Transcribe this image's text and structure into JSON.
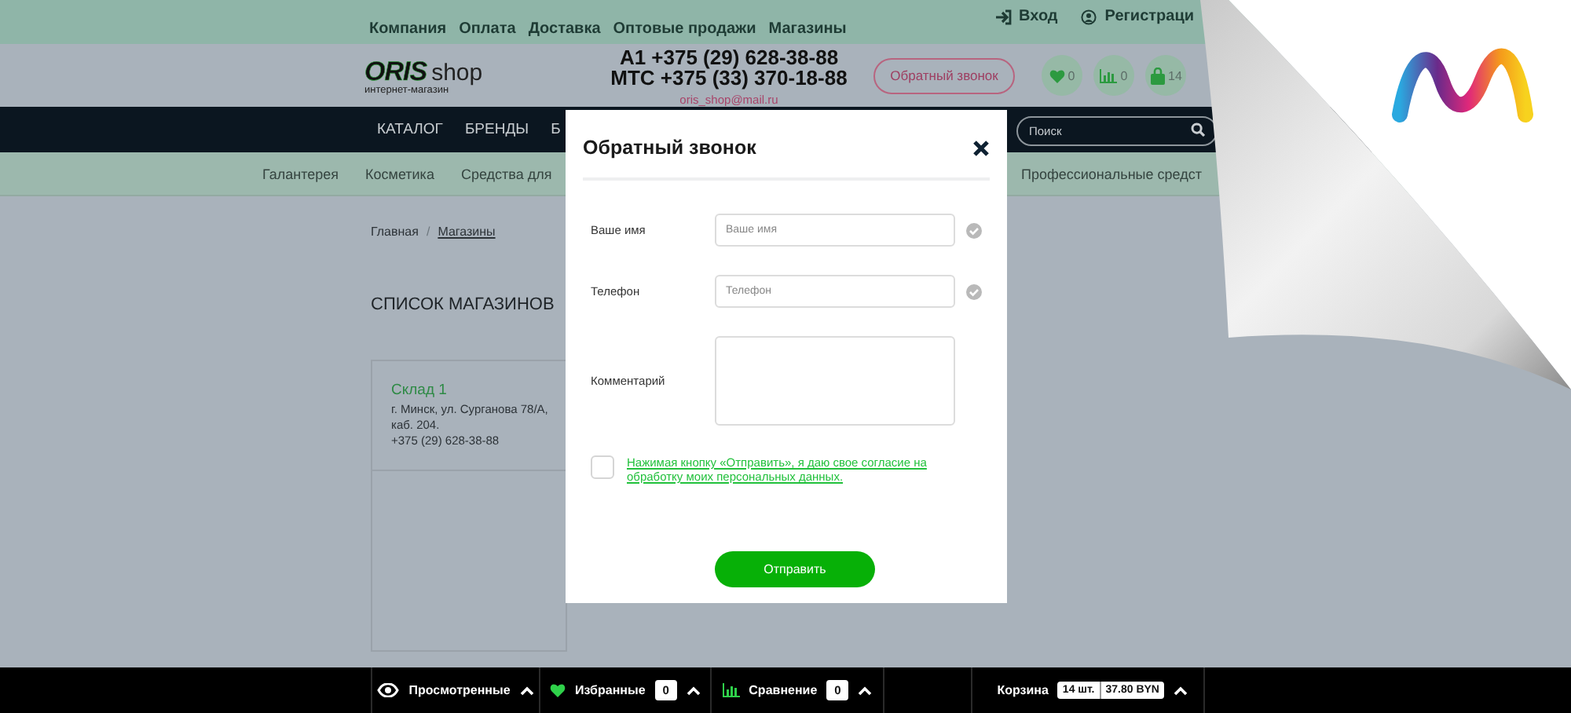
{
  "top_links": [
    {
      "label": "Компания"
    },
    {
      "label": "Оплата"
    },
    {
      "label": "Доставка"
    },
    {
      "label": "Оптовые продажи"
    },
    {
      "label": "Магазины"
    }
  ],
  "account": [
    {
      "kind": "login",
      "label": "Вход"
    },
    {
      "kind": "register",
      "label": "Регистраци"
    }
  ],
  "logo": {
    "brand": "ORIS",
    "suffix": "shop",
    "tagline": "интернет-магазин"
  },
  "phones": [
    "A1 +375 (29) 628-38-88",
    "МТС +375 (33) 370-18-88"
  ],
  "email": "oris_shop@mail.ru",
  "callback_button": "Обратный звонок",
  "header_counters": [
    {
      "kind": "favorites",
      "count": "0"
    },
    {
      "kind": "compare",
      "count": "0"
    },
    {
      "kind": "cart",
      "count": "14"
    }
  ],
  "nav": [
    "КАТАЛОГ",
    "БРЕНДЫ",
    "Б"
  ],
  "search": {
    "placeholder": "Поиск"
  },
  "subnav": [
    "Галантерея",
    "Косметика",
    "Средства для",
    "Профессиональные средст"
  ],
  "breadcrumb": {
    "separator": "/",
    "items": [
      {
        "label": "Главная",
        "link": false
      },
      {
        "label": "Магазины",
        "link": true
      }
    ]
  },
  "page_title": "СПИСОК МАГАЗИНОВ",
  "stores": [
    {
      "name": "Склад 1",
      "address": "г. Минск, ул. Сурганова 78/А, каб. 204.",
      "phone": "+375 (29) 628-38-88"
    }
  ],
  "modal": {
    "title": "Обратный звонок",
    "fields": [
      {
        "kind": "input",
        "label": "Ваше имя",
        "placeholder": "Ваше имя"
      },
      {
        "kind": "input",
        "label": "Телефон",
        "placeholder": "Телефон"
      },
      {
        "kind": "textarea",
        "label": "Комментарий"
      }
    ],
    "consent": {
      "checked": false,
      "text": "Нажимая кнопку «Отправить», я даю свое согласие на обработку моих персональных данных."
    },
    "submit": "Отправить"
  },
  "bottom_bar": [
    {
      "kind": "viewed",
      "label": "Просмотренные"
    },
    {
      "kind": "favorites",
      "label": "Избранные",
      "count": "0"
    },
    {
      "kind": "compare",
      "label": "Сравнение",
      "count": "0"
    },
    {
      "kind": "cart",
      "label": "Корзина",
      "count": "14 шт.",
      "total": "37.80 BYN"
    }
  ]
}
